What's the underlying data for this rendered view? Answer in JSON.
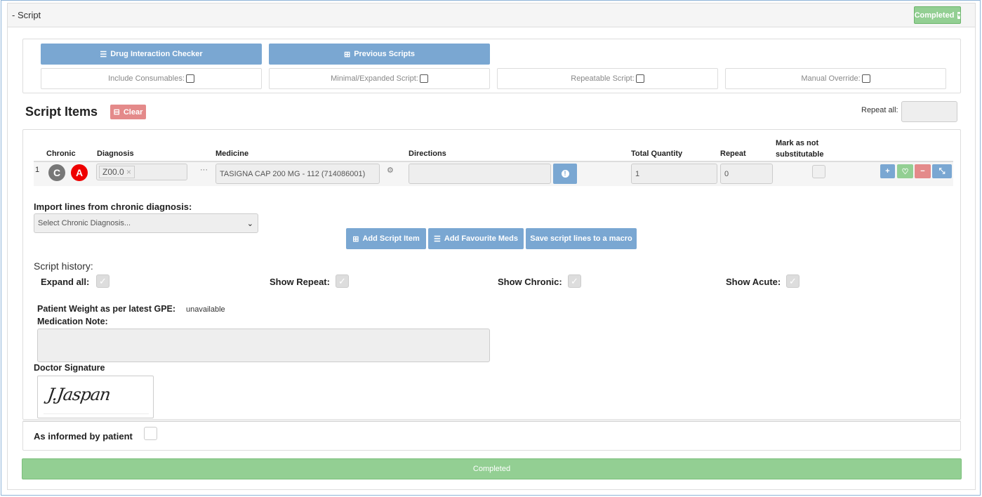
{
  "header": {
    "title": "- Script",
    "status_button": "Completed"
  },
  "toolbar": {
    "drug_interaction": "Drug Interaction Checker",
    "previous_scripts": "Previous Scripts"
  },
  "options": [
    {
      "label": "Include Consumables:",
      "checked": false
    },
    {
      "label": "Minimal/Expanded Script:",
      "checked": false
    },
    {
      "label": "Repeatable Script:",
      "checked": false
    },
    {
      "label": "Manual Override:",
      "checked": false
    }
  ],
  "script_items": {
    "title": "Script Items",
    "clear": "Clear",
    "repeat_all_label": "Repeat all:",
    "repeat_all_value": ""
  },
  "table": {
    "headers": {
      "chronic": "Chronic",
      "diagnosis": "Diagnosis",
      "medicine": "Medicine",
      "directions": "Directions",
      "total_quantity": "Total Quantity",
      "repeat": "Repeat",
      "not_substitutable": "Mark as not substitutable"
    },
    "rows": [
      {
        "num": "1",
        "chronic_badge": "C",
        "acute_badge": "A",
        "diagnosis": "Z00.0",
        "more": "···",
        "medicine": "TASIGNA CAP 200 MG - 112 (714086001)",
        "directions": "",
        "total_quantity": "1",
        "repeat": "0",
        "not_substitutable": false
      }
    ]
  },
  "import": {
    "label": "Import lines from chronic diagnosis:",
    "select_value": "Select Chronic Diagnosis..."
  },
  "actions": {
    "add_item": "Add Script Item",
    "add_fav": "Add Favourite Meds",
    "save_macro": "Save script lines to a macro"
  },
  "history": {
    "title": "Script history:",
    "expand_all": "Expand all:",
    "show_repeat": "Show Repeat:",
    "show_chronic": "Show Chronic:",
    "show_acute": "Show Acute:"
  },
  "patient": {
    "weight_label": "Patient Weight as per latest GPE:",
    "weight_value": "unavailable",
    "note_label": "Medication Note:",
    "note_value": ""
  },
  "signature": {
    "label": "Doctor Signature",
    "text": "J.Jaspan"
  },
  "informed": {
    "label": "As informed by patient",
    "checked": false
  },
  "footer": {
    "completed": "Completed"
  },
  "colors": {
    "primary": "#7aa7d2",
    "success": "#93cf93",
    "danger": "#e48a8a",
    "acute": "#e00000",
    "chronic": "#777777"
  }
}
